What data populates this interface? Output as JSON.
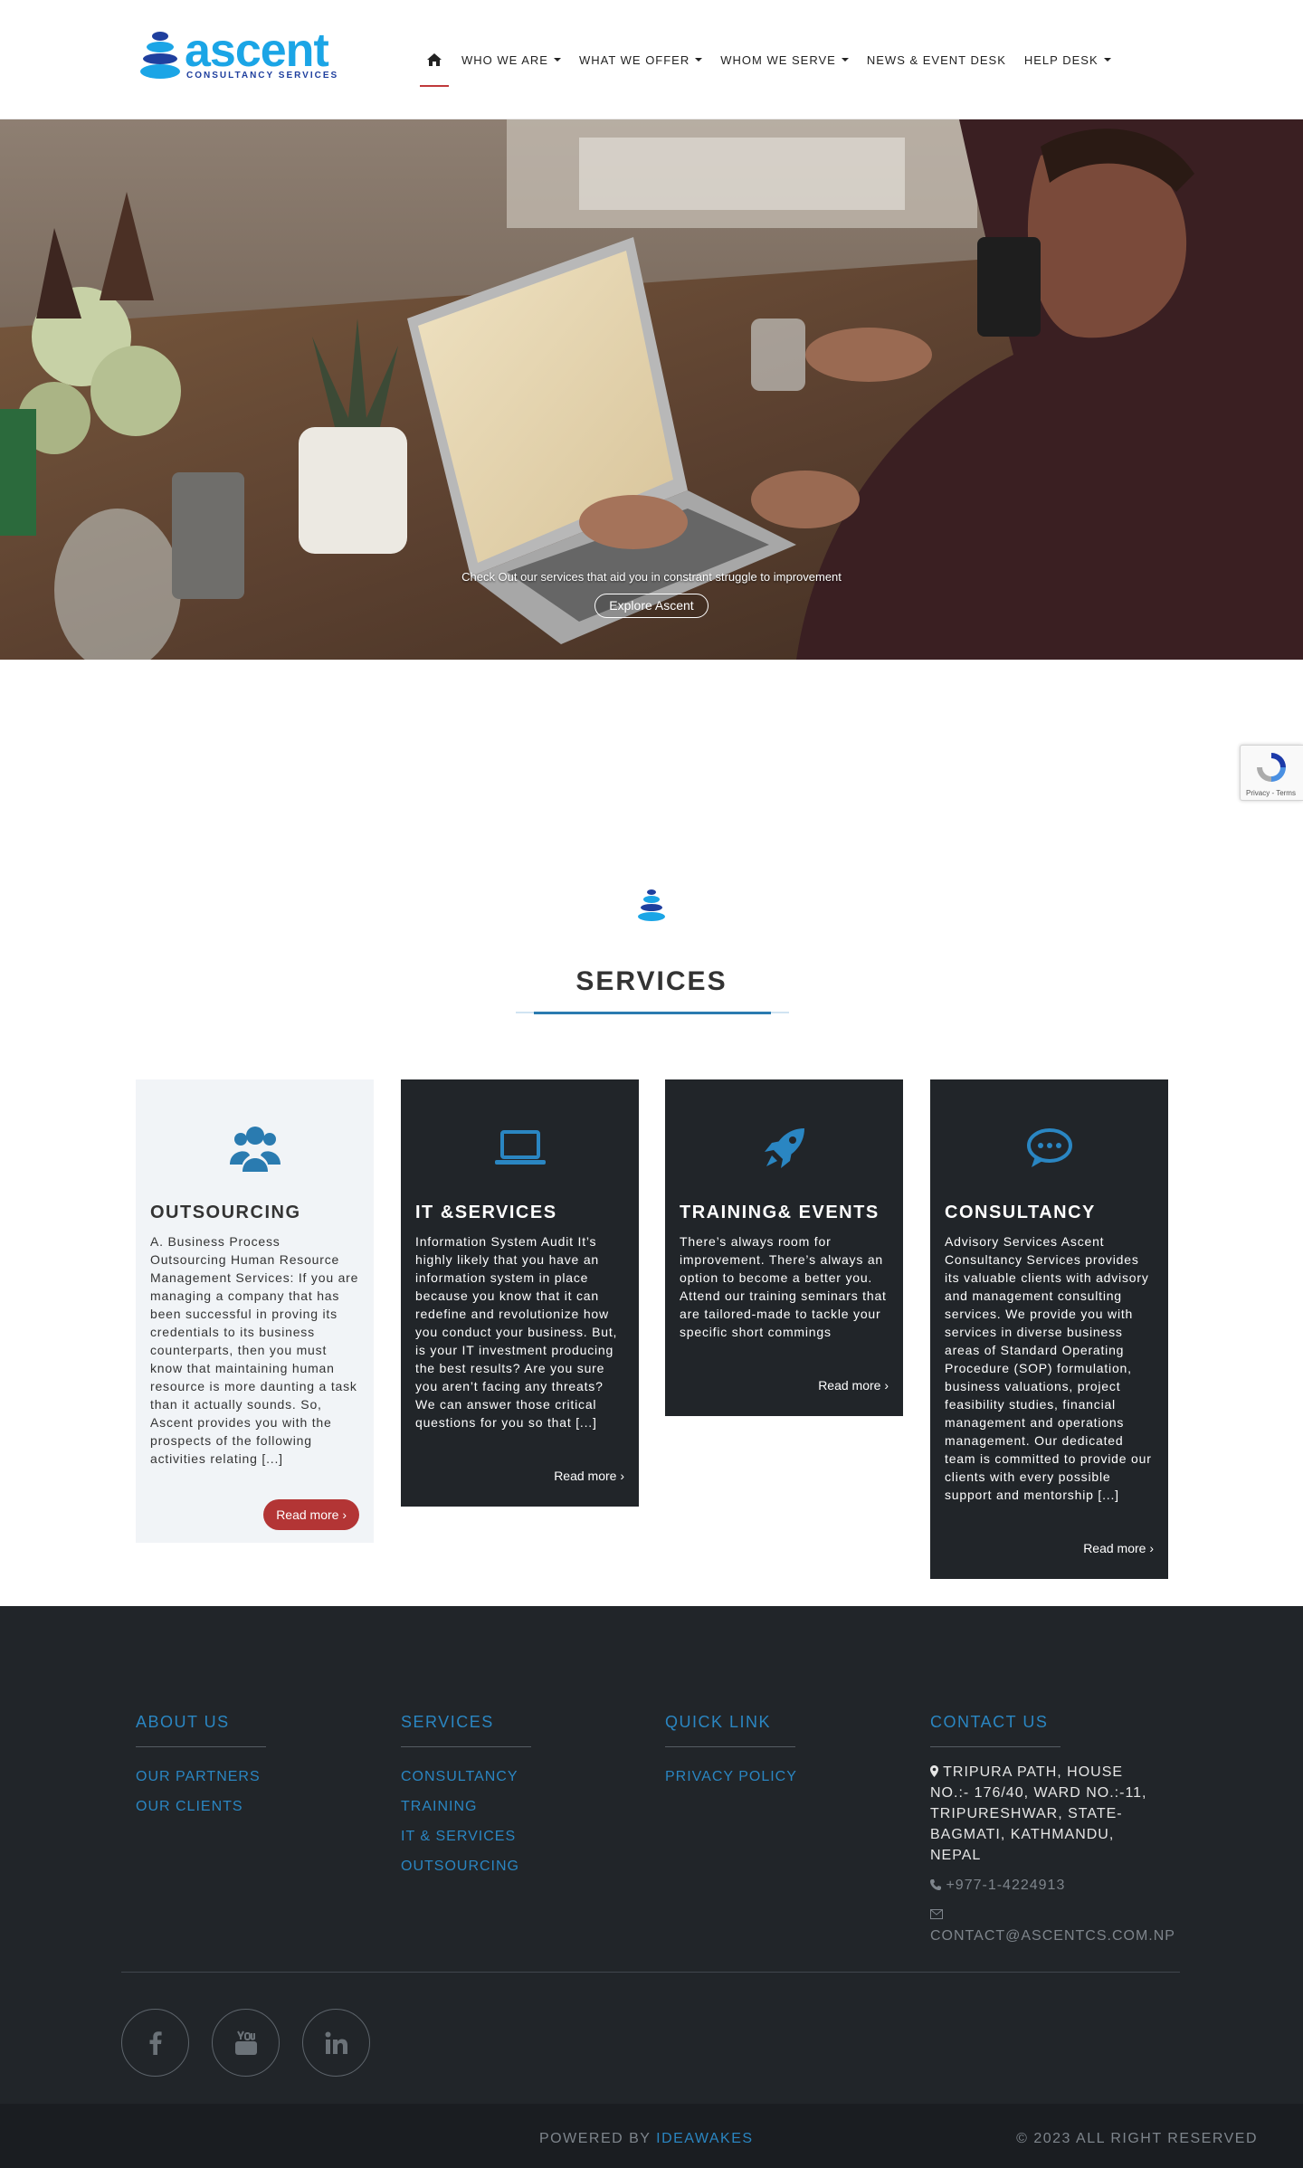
{
  "brand": {
    "name": "ascent",
    "tagline": "CONSULTANCY SERVICES"
  },
  "nav": {
    "items": [
      {
        "label": "WHO WE ARE",
        "dropdown": true
      },
      {
        "label": "WHAT WE OFFER",
        "dropdown": true
      },
      {
        "label": "WHOM WE SERVE",
        "dropdown": true
      },
      {
        "label": "NEWS & EVENT DESK",
        "dropdown": false
      },
      {
        "label": "HELP DESK",
        "dropdown": true
      }
    ]
  },
  "hero": {
    "caption": "Check Out our services that aid you in constrant struggle to improvement",
    "button": "Explore Ascent"
  },
  "recaptcha": {
    "terms": "Privacy - Terms"
  },
  "services": {
    "title": "SERVICES",
    "cards": [
      {
        "icon": "users-icon",
        "title": "OUTSOURCING",
        "text": "A. Business Process Outsourcing Human Resource Management Services: If you are managing a company that has been successful in proving its credentials to its business counterparts, then you must know that maintaining human resource is more daunting a task than it actually sounds. So, Ascent provides you with the prospects of the following activities relating [...]",
        "more": "Read more ›"
      },
      {
        "icon": "laptop-icon",
        "title": "IT &SERVICES",
        "text": "Information System Audit It’s highly likely that you have an information system in place because you know that it can redefine and revolutionize how you conduct your business. But, is your IT investment producing the best results? Are you sure you aren’t facing any threats? We can answer those critical questions for you so that [...]",
        "more": "Read more ›"
      },
      {
        "icon": "rocket-icon",
        "title": "TRAINING& EVENTS",
        "text": "There’s always room for improvement. There’s always an option to become a better you. Attend our training seminars that are tailored-made to tackle your specific short commings",
        "more": "Read more ›"
      },
      {
        "icon": "comment-icon",
        "title": "CONSULTANCY",
        "text": "Advisory Services Ascent Consultancy Services provides its valuable clients with advisory and management consulting services. We provide you with services in diverse business areas of Standard Operating Procedure (SOP) formulation, business valuations, project feasibility studies, financial management and operations management. Our dedicated team is committed to provide our clients with every possible support and mentorship [...]",
        "more": "Read more ›"
      }
    ]
  },
  "footer": {
    "about": {
      "title": "ABOUT US",
      "links": [
        "OUR PARTNERS",
        "OUR CLIENTS"
      ]
    },
    "services": {
      "title": "SERVICES",
      "links": [
        "CONSULTANCY",
        "TRAINING",
        "IT & SERVICES",
        "OUTSOURCING"
      ]
    },
    "quick": {
      "title": "QUICK LINK",
      "links": [
        "PRIVACY POLICY"
      ]
    },
    "contact": {
      "title": "CONTACT US",
      "address": "TRIPURA PATH, HOUSE NO.:- 176/40, WARD NO.:-11, TRIPURESHWAR, STATE-BAGMATI, KATHMANDU, NEPAL",
      "phone": "+977-1-4224913",
      "email": "CONTACT@ASCENTCS.COM.NP"
    },
    "powered_label": "POWERED BY",
    "powered_by": "IDEAWAKES",
    "copyright": "© 2023 ALL RIGHT RESERVED"
  },
  "colors": {
    "accent": "#2a86c2",
    "brand": "#1ba5e6",
    "red": "#b33535",
    "dark": "#212529"
  }
}
